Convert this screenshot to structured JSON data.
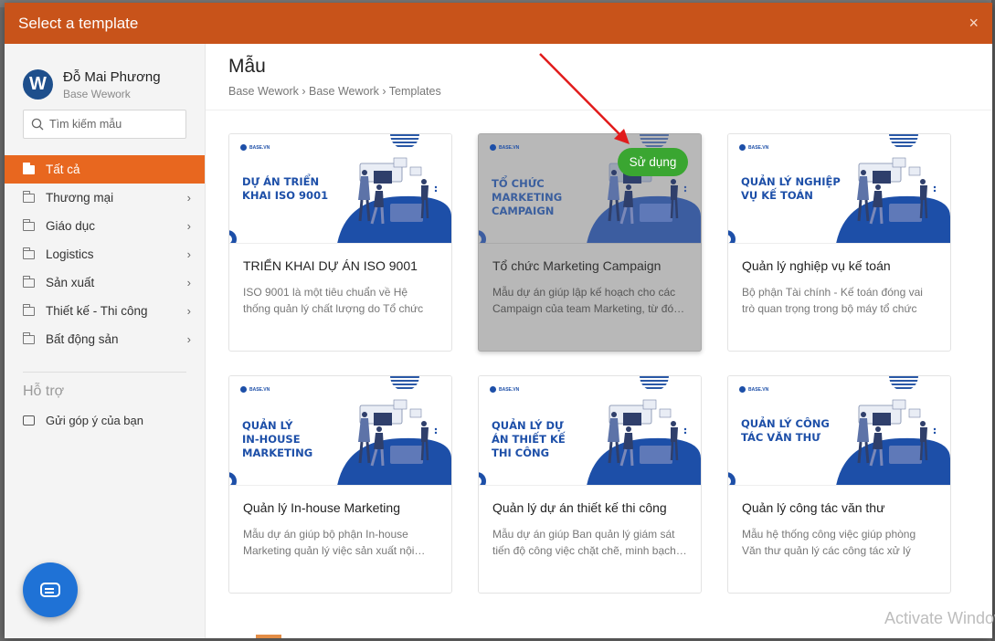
{
  "modal": {
    "title": "Select a template",
    "close_icon": "×"
  },
  "profile": {
    "logo_letter": "W",
    "name": "Đỗ Mai Phương",
    "org": "Base Wework"
  },
  "search": {
    "placeholder": "Tìm kiếm mẫu"
  },
  "categories": [
    {
      "label": "Tất cả",
      "active": true,
      "has_chevron": false
    },
    {
      "label": "Thương mại",
      "has_chevron": true
    },
    {
      "label": "Giáo dục",
      "has_chevron": true
    },
    {
      "label": "Logistics",
      "has_chevron": true
    },
    {
      "label": "Sản xuất",
      "has_chevron": true
    },
    {
      "label": "Thiết kế - Thi công",
      "has_chevron": true
    },
    {
      "label": "Bất động sản",
      "has_chevron": true
    }
  ],
  "chevron": "›",
  "support": {
    "title": "Hỗ trợ",
    "feedback_label": "Gửi góp ý của bạn"
  },
  "main": {
    "title": "Mẫu",
    "breadcrumb": "Base Wework › Base Wework › Templates"
  },
  "use_button": "Sử dụng",
  "thumb_brand": "BASE.VN",
  "templates": [
    {
      "thumb_lines": [
        "DỰ ÁN TRIỂN",
        "KHAI ISO 9001"
      ],
      "title": "TRIỂN KHAI DỰ ÁN ISO 9001",
      "desc": "ISO 9001 là một tiêu chuẩn về Hệ thống quản lý chất lượng do Tổ chức Tiêu…"
    },
    {
      "thumb_lines": [
        "TỔ CHỨC",
        "MARKETING",
        "CAMPAIGN"
      ],
      "title": "Tổ chức Marketing Campaign",
      "desc": "Mẫu dự án giúp lập kế hoạch cho các Campaign của team Marketing, từ đó…",
      "hovered": true
    },
    {
      "thumb_lines": [
        "QUẢN LÝ NGHIỆP",
        "VỤ KẾ TOÁN"
      ],
      "title": "Quản lý nghiệp vụ kế toán",
      "desc": "Bộ phận Tài chính - Kế toán đóng vai trò quan trọng trong bộ máy tổ chức để…"
    },
    {
      "thumb_lines": [
        "QUẢN LÝ",
        "IN-HOUSE",
        "MARKETING"
      ],
      "title": "Quản lý In-house Marketing",
      "desc": "Mẫu dự án giúp bộ phận In-house Marketing quản lý việc sản xuất nội…"
    },
    {
      "thumb_lines": [
        "QUẢN LÝ DỰ",
        "ÁN THIẾT KẾ",
        "THI CÔNG"
      ],
      "title": "Quản lý dự án thiết kế thi công",
      "desc": "Mẫu dự án giúp Ban quản lý giám sát tiến độ công việc chặt chẽ, minh bạch…"
    },
    {
      "thumb_lines": [
        "QUẢN LÝ CÔNG",
        "TÁC VĂN THƯ"
      ],
      "title": "Quản lý công tác văn thư",
      "desc": "Mẫu hệ thống công việc giúp phòng Văn thư quản lý các công tác xử lý hồ…"
    }
  ],
  "watermark": "Activate Windows",
  "colors": {
    "header": "#c8531a",
    "active": "#e8671f",
    "use_button": "#3aa631",
    "brand_blue": "#1d4fa8",
    "chat": "#1f72d6"
  }
}
